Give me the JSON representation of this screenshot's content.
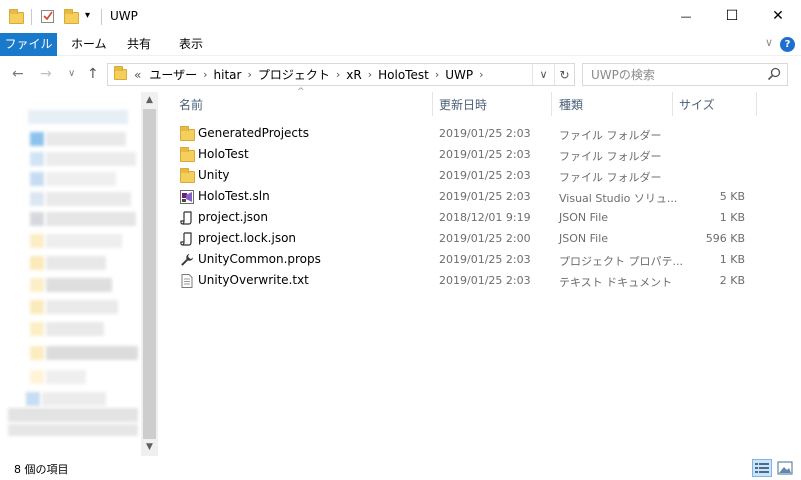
{
  "window": {
    "title": "UWP",
    "minimize_glyph": "—",
    "maximize_glyph": "☐",
    "close_glyph": "✕"
  },
  "ribbon": {
    "tabs": [
      "ファイル",
      "ホーム",
      "共有",
      "表示"
    ],
    "collapse_glyph": "∨",
    "help_glyph": "?"
  },
  "nav": {
    "back_glyph": "←",
    "forward_glyph": "→",
    "recent_glyph": "∨",
    "up_glyph": "↑"
  },
  "address": {
    "overflow": "«",
    "path": [
      "ユーザー",
      "hitar",
      "プロジェクト",
      "xR",
      "HoloTest",
      "UWP"
    ],
    "separator": "›",
    "dropdown_glyph": "∨",
    "refresh_glyph": "↻"
  },
  "search": {
    "placeholder": "UWPの検索"
  },
  "columns": {
    "name": "名前",
    "date": "更新日時",
    "type": "種類",
    "size": "サイズ",
    "sort_glyph": "^"
  },
  "files": [
    {
      "name": "GeneratedProjects",
      "date": "2019/01/25 2:03",
      "type": "ファイル フォルダー",
      "size": "",
      "icon": "folder-icon"
    },
    {
      "name": "HoloTest",
      "date": "2019/01/25 2:03",
      "type": "ファイル フォルダー",
      "size": "",
      "icon": "folder-icon"
    },
    {
      "name": "Unity",
      "date": "2019/01/25 2:03",
      "type": "ファイル フォルダー",
      "size": "",
      "icon": "folder-icon"
    },
    {
      "name": "HoloTest.sln",
      "date": "2019/01/25 2:03",
      "type": "Visual Studio ソリュ...",
      "size": "5 KB",
      "icon": "visual-studio-solution-icon"
    },
    {
      "name": "project.json",
      "date": "2018/12/01 9:19",
      "type": "JSON File",
      "size": "1 KB",
      "icon": "json-file-icon"
    },
    {
      "name": "project.lock.json",
      "date": "2019/01/25 2:00",
      "type": "JSON File",
      "size": "596 KB",
      "icon": "json-file-icon"
    },
    {
      "name": "UnityCommon.props",
      "date": "2019/01/25 2:03",
      "type": "プロジェクト プロパテ...",
      "size": "1 KB",
      "icon": "wrench-icon"
    },
    {
      "name": "UnityOverwrite.txt",
      "date": "2019/01/25 2:03",
      "type": "テキスト ドキュメント",
      "size": "2 KB",
      "icon": "text-file-icon"
    }
  ],
  "status": {
    "item_count": "8 個の項目"
  },
  "scrollbar": {
    "up_glyph": "▲",
    "down_glyph": "▼"
  },
  "colors": {
    "accent": "#1979ca",
    "folder": "#f4cf5c",
    "header_text": "#4c607a"
  }
}
